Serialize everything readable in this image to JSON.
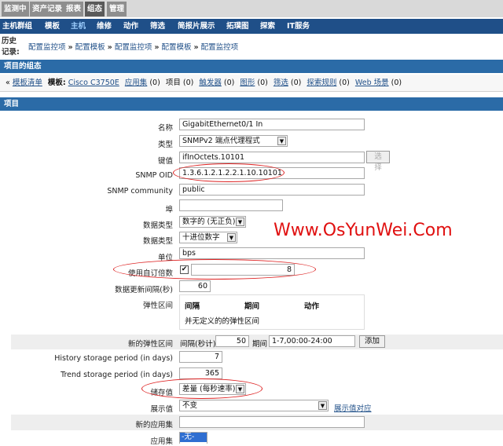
{
  "top_tabs": [
    {
      "label": "监测中"
    },
    {
      "label": "资产记录"
    },
    {
      "label": "报表"
    },
    {
      "label": "组态"
    },
    {
      "label": "管理"
    }
  ],
  "menu": [
    "主机群组",
    "模板",
    "主机",
    "维修",
    "动作",
    "筛选",
    "简报片展示",
    "拓璞图",
    "探索",
    "IT服务"
  ],
  "history": {
    "label": "历史记录:",
    "crumbs": [
      "配置监控项",
      "配置模板",
      "配置监控项",
      "配置模板",
      "配置监控项"
    ]
  },
  "section1_title": "项目的组态",
  "tabs": {
    "back": "模板清单",
    "template_label": "模板:",
    "template_name": "Cisco C3750E",
    "apps": "应用集",
    "apps_count": "(0)",
    "items": "项目",
    "items_count": "(0)",
    "triggers": "触发器",
    "triggers_count": "(0)",
    "graphs": "图形",
    "graphs_count": "(0)",
    "screens": "筛选",
    "screens_count": "(0)",
    "discovery": "探索规则",
    "discovery_count": "(0)",
    "web": "Web 场景",
    "web_count": "(0)"
  },
  "section2_title": "项目",
  "form": {
    "name_label": "名称",
    "name_value": "GigabitEthernet0/1 In",
    "type_label": "类型",
    "type_value": "SNMPv2 端点代理程式",
    "key_label": "键值",
    "key_value": "ifInOctets.10101",
    "select_btn": "选择",
    "oid_label": "SNMP OID",
    "oid_value": "1.3.6.1.2.1.2.2.1.10.10101",
    "community_label": "SNMP community",
    "community_value": "public",
    "port_label": "埠",
    "port_value": "",
    "datatype_label": "数据类型",
    "datatype_value": "数字的 (无正负)",
    "dataformat_label": "数据类型",
    "dataformat_value": "十进位数字",
    "unit_label": "单位",
    "unit_value": "bps",
    "multiplier_label": "使用自订倍数",
    "multiplier_checked": "✔",
    "multiplier_value": "8",
    "interval_label": "数据更新间隔(秒)",
    "interval_value": "60",
    "flex_label": "弹性区间",
    "flex_col_interval": "间隔",
    "flex_col_period": "期间",
    "flex_col_action": "动作",
    "flex_empty": "并无定义的的弹性区间",
    "newflex_label": "新的弹性区间",
    "newflex_interval_label": "间隔(秒计)",
    "newflex_interval_value": "50",
    "newflex_period_label": "期间",
    "newflex_period_value": "1-7,00:00-24:00",
    "add_btn": "添加",
    "history_label": "History storage period (in days)",
    "history_value": "7",
    "trend_label": "Trend storage period (in days)",
    "trend_value": "365",
    "store_label": "储存值",
    "store_value": "差量 (每秒速率)",
    "show_label": "展示值",
    "show_value": "不变",
    "show_link": "展示值对应",
    "newapp_label": "新的应用集",
    "newapp_value": "",
    "apps_label": "应用集",
    "apps_value": "-无-"
  },
  "watermark": "Www.OsYunWei.Com",
  "colors": {
    "menubar": "#1f4f88",
    "section": "#2b6ba7",
    "annotation": "#dd2222",
    "watermark": "#e01010"
  }
}
